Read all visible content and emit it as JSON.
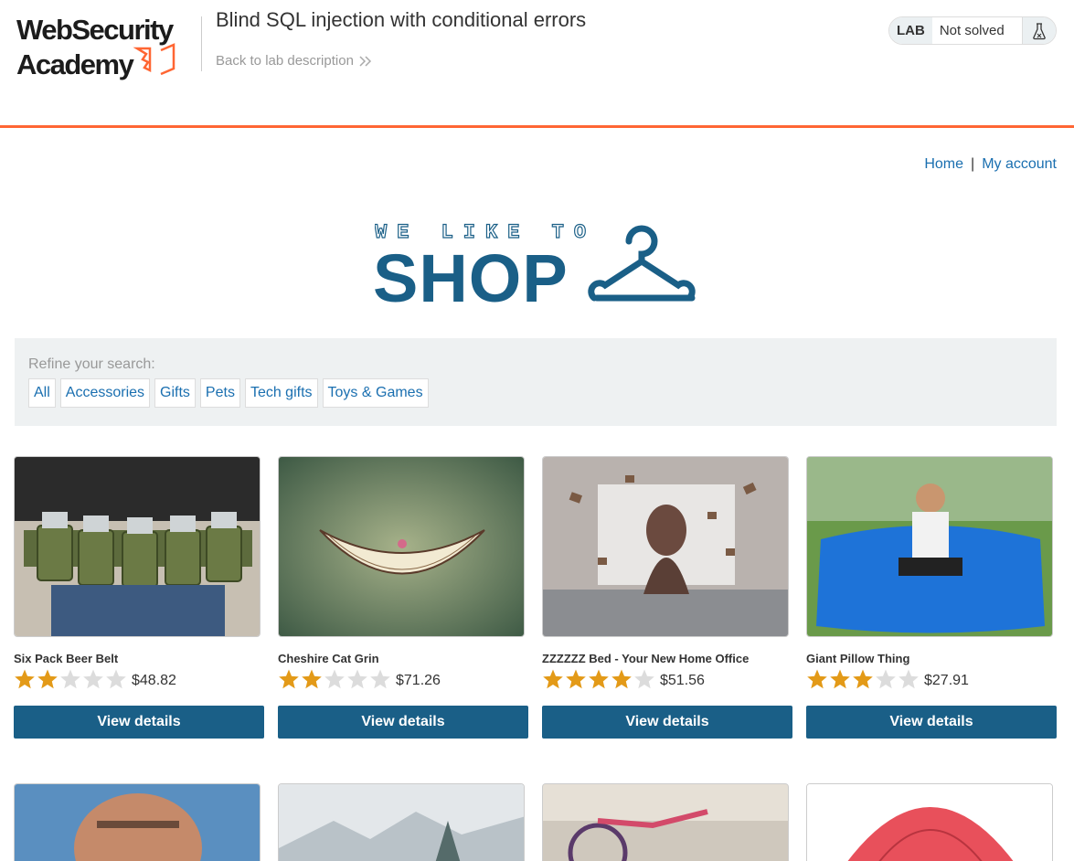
{
  "header": {
    "logo_text_line1": "WebSecurity",
    "logo_text_line2": "Academy",
    "lab_title": "Blind SQL injection with conditional errors",
    "back_link": "Back to lab description",
    "lab_badge": "LAB",
    "lab_status": "Not solved",
    "accent_color": "#ff6633"
  },
  "nav": {
    "home": "Home",
    "separator": "|",
    "my_account": "My account"
  },
  "banner": {
    "line1": "WE LIKE TO",
    "line2": "SHOP",
    "color": "#1a5f87"
  },
  "filter": {
    "label": "Refine your search:",
    "categories": [
      "All",
      "Accessories",
      "Gifts",
      "Pets",
      "Tech gifts",
      "Toys & Games"
    ]
  },
  "products": [
    {
      "name": "Six Pack Beer Belt",
      "rating": 2,
      "price": "$48.82",
      "button": "View details"
    },
    {
      "name": "Cheshire Cat Grin",
      "rating": 2,
      "price": "$71.26",
      "button": "View details"
    },
    {
      "name": "ZZZZZZ Bed - Your New Home Office",
      "rating": 4,
      "price": "$51.56",
      "button": "View details"
    },
    {
      "name": "Giant Pillow Thing",
      "rating": 3,
      "price": "$27.91",
      "button": "View details"
    }
  ],
  "rating_max": 5,
  "colors": {
    "star_filled": "#e39a18",
    "star_empty": "#dcdcdc",
    "button": "#1a5f87",
    "link": "#1a6fb0"
  }
}
